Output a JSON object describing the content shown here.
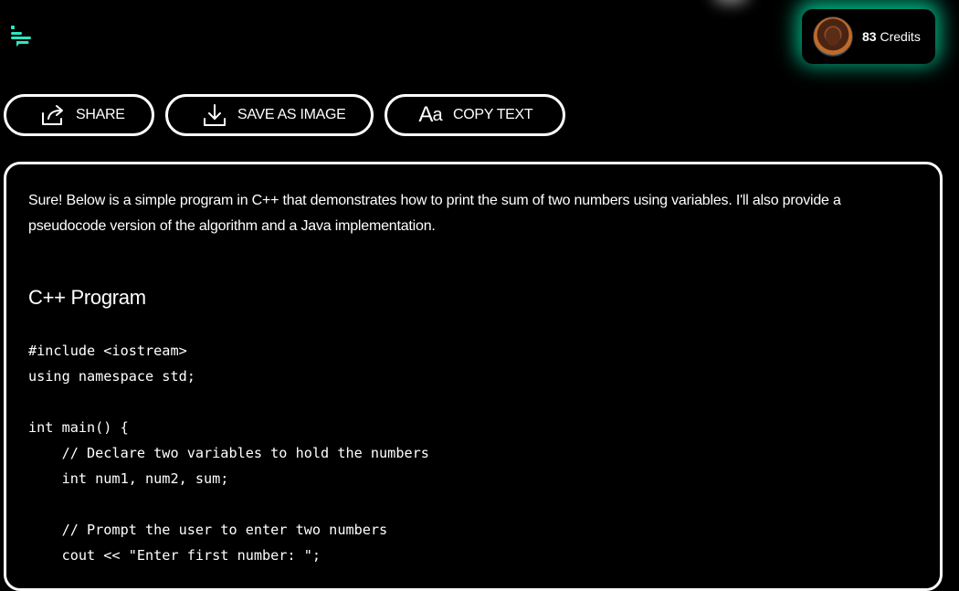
{
  "header": {
    "logo_icon": "menu-lines-icon",
    "accent_color": "#2ee6c0",
    "credits": {
      "count": "83",
      "label": "Credits",
      "avatar_icon": "user-avatar"
    }
  },
  "actions": {
    "share": {
      "label": "SHARE",
      "icon": "share-icon"
    },
    "save_image": {
      "label": "SAVE AS IMAGE",
      "icon": "download-icon"
    },
    "copy_text": {
      "label": "COPY TEXT",
      "icon": "text-format-icon"
    }
  },
  "response": {
    "intro": "Sure! Below is a simple program in C++ that demonstrates how to print the sum of two numbers using variables. I'll also provide a pseudocode version of the algorithm and a Java implementation.",
    "heading": "C++ Program",
    "code": "#include <iostream>\nusing namespace std;\n\nint main() {\n    // Declare two variables to hold the numbers\n    int num1, num2, sum;\n\n    // Prompt the user to enter two numbers\n    cout << \"Enter first number: \";"
  }
}
